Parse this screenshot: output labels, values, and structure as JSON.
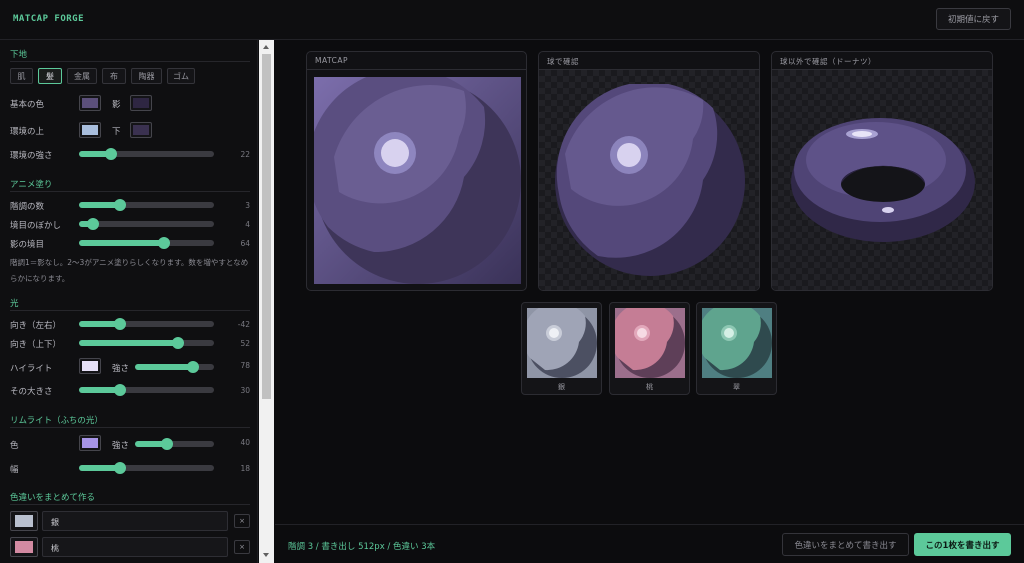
{
  "app": {
    "title": "MATCAP FORGE",
    "reset_label": "初期値に戻す"
  },
  "base": {
    "title": "下地",
    "presets": [
      "肌",
      "髪",
      "金属",
      "布",
      "陶器",
      "ゴム"
    ],
    "active_preset": "髪",
    "base_color_label": "基本の色",
    "shadow_label": "影",
    "env_top_label": "環境の上",
    "env_bottom_label": "下",
    "env_strength_label": "環境の強さ",
    "env_strength_value": "22",
    "colors": {
      "base": "#5b4f7a",
      "shadow": "#2e2642",
      "env_top": "#a9bede",
      "env_bottom": "#3a3150"
    }
  },
  "anime": {
    "title": "アニメ塗り",
    "steps_label": "階調の数",
    "steps_value": "3",
    "blur_label": "境目のぼかし",
    "blur_value": "4",
    "shadow_edge_label": "影の境目",
    "shadow_edge_value": "64",
    "note": "階調1＝影なし。2〜3がアニメ塗りらしくなります。数を増やすとなめらかになります。"
  },
  "light": {
    "title": "光",
    "dir_lr_label": "向き（左右）",
    "dir_lr_value": "-42",
    "dir_ud_label": "向き（上下）",
    "dir_ud_value": "52",
    "highlight_label": "ハイライト",
    "strength_label": "強さ",
    "highlight_value": "78",
    "size_label": "その大きさ",
    "size_value": "30",
    "colors": {
      "highlight": "#e6e0f7"
    }
  },
  "rim": {
    "title": "リムライト（ふちの光）",
    "color_label": "色",
    "strength_label": "強さ",
    "strength_value": "40",
    "width_label": "幅",
    "width_value": "18",
    "colors": {
      "rim": "#a694e6"
    }
  },
  "variants": {
    "title": "色違いをまとめて作る",
    "items": [
      {
        "name": "銀",
        "color": "#b9c0cf"
      },
      {
        "name": "桃",
        "color": "#d38aa2"
      }
    ],
    "delete_label": "×"
  },
  "previews": {
    "matcap_label": "MATCAP",
    "sphere_label": "球で確認",
    "donut_label": "球以外で確認（ドーナツ）"
  },
  "thumbnails": [
    {
      "label": "銀",
      "color": "#b9c0cf"
    },
    {
      "label": "桃",
      "color": "#d38aa2"
    },
    {
      "label": "翠",
      "color": "#5fae97"
    }
  ],
  "footer": {
    "status": "階調 3 / 書き出し 512px / 色違い 3本",
    "batch_label": "色違いをまとめて書き出す",
    "export_label": "この1枚を書き出す"
  },
  "accent_color": "#5cc99a"
}
